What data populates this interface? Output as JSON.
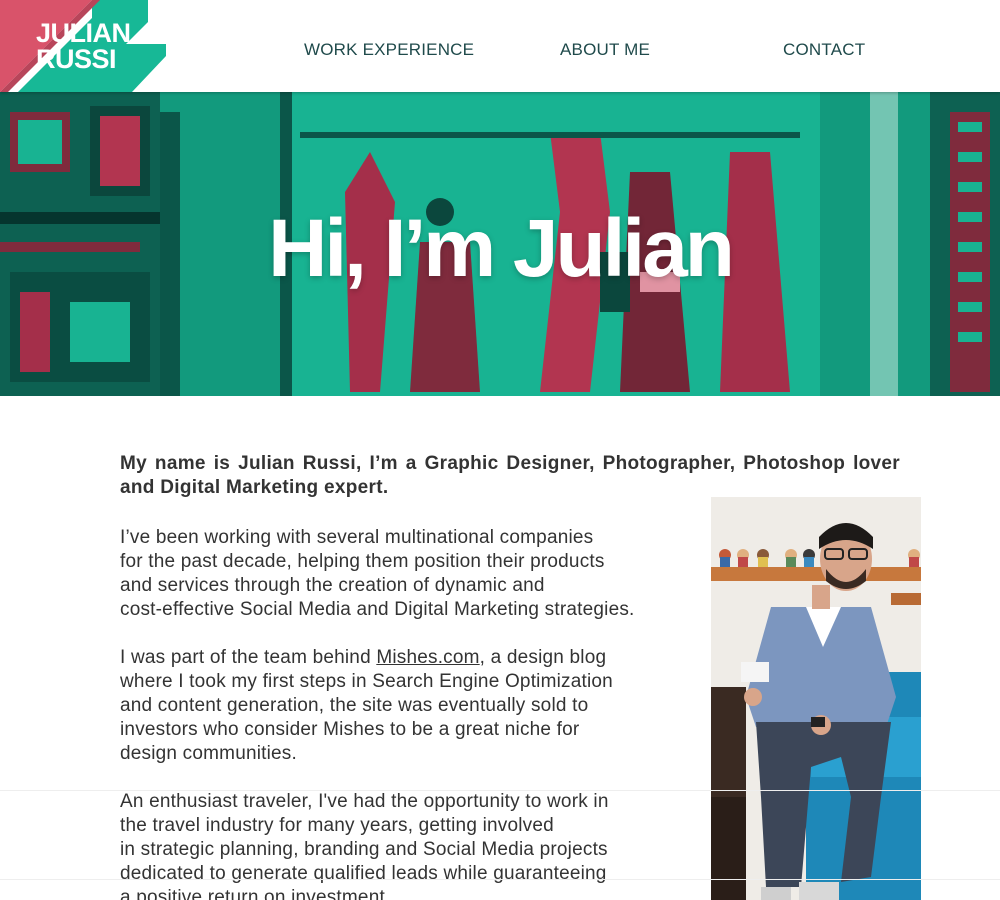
{
  "header": {
    "logo_line1": "JULIAN",
    "logo_line2": "RUSSI",
    "nav": [
      "WORK EXPERIENCE",
      "ABOUT ME",
      "CONTACT"
    ]
  },
  "hero": {
    "title": "Hi, I’m Julian"
  },
  "about": {
    "intro": "My name is Julian Russi, I’m a Graphic Designer, Photographer, Photoshop lover and Digital Marketing expert.",
    "p1_lines": [
      "I’ve been working with several multinational companies",
      "for the past decade, helping them position their products",
      "and services through the creation of dynamic and",
      "cost-effective Social Media and Digital Marketing strategies."
    ],
    "p2_before_link": "I was part of the team behind ",
    "p2_link": "Mishes.com",
    "p2_after_link": ", a design blog",
    "p2_lines": [
      "where I took my first steps in Search Engine Optimization",
      "and content generation, the site was eventually sold to",
      "investors who consider Mishes to be a great niche for",
      "design communities."
    ],
    "p3_lines": [
      "An enthusiast traveler, I've had the opportunity to work in",
      "the travel industry for many years, getting involved",
      "in strategic planning, branding and Social Media projects",
      "dedicated to generate qualified leads while guaranteeing",
      "a positive return on investment."
    ]
  },
  "colors": {
    "brand_red": "#d9536a",
    "brand_green": "#17b896",
    "nav_text": "#1f4a4b"
  }
}
